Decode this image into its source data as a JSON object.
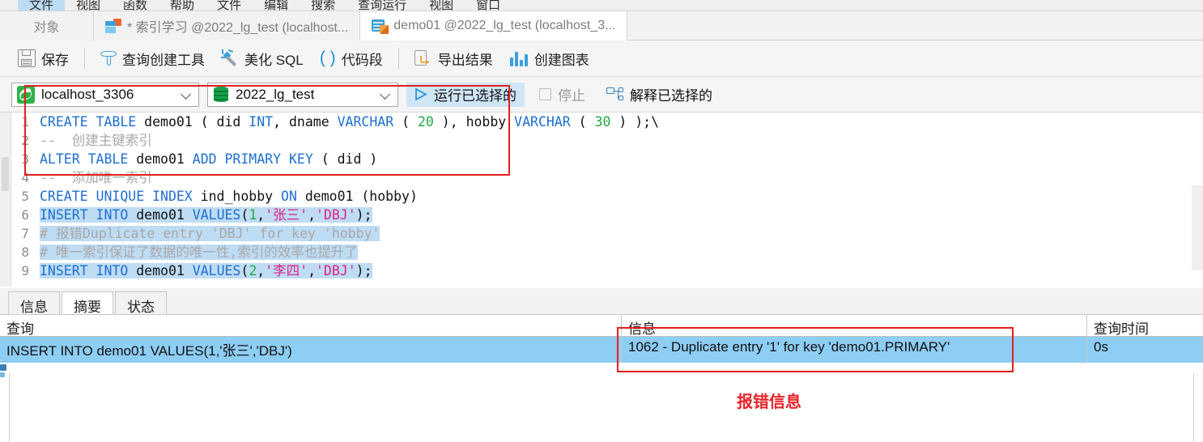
{
  "ribbon": {
    "tabs": [
      {
        "label": "文件",
        "active": true
      },
      {
        "label": "视图",
        "active": false
      },
      {
        "label": "函数",
        "active": false
      },
      {
        "label": "帮助",
        "active": false
      },
      {
        "label": "文件",
        "active": false
      },
      {
        "label": "编辑",
        "active": false
      },
      {
        "label": "搜索",
        "active": false
      },
      {
        "label": "查询运行",
        "active": false
      },
      {
        "label": "视图",
        "active": false
      },
      {
        "label": "窗口",
        "active": false
      }
    ]
  },
  "tabbar": {
    "objects_label": "对象",
    "tabs": [
      {
        "label": "* 索引学习 @2022_lg_test (localhost...",
        "icon": "query-icon",
        "active": false
      },
      {
        "label": "demo01 @2022_lg_test (localhost_3...",
        "icon": "table-editor-icon",
        "active": true
      }
    ]
  },
  "toolbar": {
    "save_label": "保存",
    "query_builder_label": "查询创建工具",
    "beautify_label": "美化 SQL",
    "snippet_label": "代码段",
    "export_label": "导出结果",
    "chart_label": "创建图表"
  },
  "runbar": {
    "connection": "localhost_3306",
    "database": "2022_lg_test",
    "run_selected_label": "运行已选择的",
    "stop_label": "停止",
    "explain_selected_label": "解释已选择的"
  },
  "editor": {
    "lines": [
      {
        "n": "1",
        "highlight": false,
        "tokens": [
          {
            "t": "CREATE TABLE ",
            "c": "kw"
          },
          {
            "t": "demo01",
            "c": "id"
          },
          {
            "t": " ( did ",
            "c": "pl"
          },
          {
            "t": "INT",
            "c": "kw"
          },
          {
            "t": ", dname ",
            "c": "pl"
          },
          {
            "t": "VARCHAR",
            "c": "kw"
          },
          {
            "t": " ( ",
            "c": "pl"
          },
          {
            "t": "20",
            "c": "num"
          },
          {
            "t": " ), hobby ",
            "c": "pl"
          },
          {
            "t": "VARCHAR",
            "c": "kw"
          },
          {
            "t": " ( ",
            "c": "pl"
          },
          {
            "t": "30",
            "c": "num"
          },
          {
            "t": " ) );\\",
            "c": "pl"
          }
        ]
      },
      {
        "n": "2",
        "highlight": false,
        "tokens": [
          {
            "t": "--  创建主键索引",
            "c": "cmt"
          }
        ]
      },
      {
        "n": "3",
        "highlight": false,
        "tokens": [
          {
            "t": "ALTER TABLE ",
            "c": "kw"
          },
          {
            "t": "demo01",
            "c": "id"
          },
          {
            "t": " ",
            "c": "pl"
          },
          {
            "t": "ADD PRIMARY KEY",
            "c": "kw"
          },
          {
            "t": " ( did )",
            "c": "pl"
          }
        ]
      },
      {
        "n": "4",
        "highlight": false,
        "tokens": [
          {
            "t": "--  添加唯一索引",
            "c": "cmt"
          }
        ]
      },
      {
        "n": "5",
        "highlight": false,
        "tokens": [
          {
            "t": "CREATE UNIQUE INDEX",
            "c": "kw"
          },
          {
            "t": " ind_hobby ",
            "c": "pl"
          },
          {
            "t": "ON",
            "c": "kw"
          },
          {
            "t": " demo01 (hobby)",
            "c": "pl"
          }
        ]
      },
      {
        "n": "6",
        "highlight": true,
        "tokens": [
          {
            "t": "INSERT INTO ",
            "c": "kw"
          },
          {
            "t": "demo01",
            "c": "id"
          },
          {
            "t": " ",
            "c": "pl"
          },
          {
            "t": "VALUES",
            "c": "kw"
          },
          {
            "t": "(",
            "c": "pl"
          },
          {
            "t": "1",
            "c": "num"
          },
          {
            "t": ",",
            "c": "pl"
          },
          {
            "t": "'张三'",
            "c": "str"
          },
          {
            "t": ",",
            "c": "pl"
          },
          {
            "t": "'DBJ'",
            "c": "str"
          },
          {
            "t": ");",
            "c": "pl"
          }
        ]
      },
      {
        "n": "7",
        "highlight": true,
        "tokens": [
          {
            "t": "# 报错Duplicate entry 'DBJ' for key 'hobby'",
            "c": "cmt"
          }
        ]
      },
      {
        "n": "8",
        "highlight": true,
        "tokens": [
          {
            "t": "# 唯一索引保证了数据的唯一性,索引的效率也提升了",
            "c": "cmt"
          }
        ]
      },
      {
        "n": "9",
        "highlight": true,
        "tokens": [
          {
            "t": "INSERT INTO ",
            "c": "kw"
          },
          {
            "t": "demo01",
            "c": "id"
          },
          {
            "t": " ",
            "c": "pl"
          },
          {
            "t": "VALUES",
            "c": "kw"
          },
          {
            "t": "(",
            "c": "pl"
          },
          {
            "t": "2",
            "c": "num"
          },
          {
            "t": ",",
            "c": "pl"
          },
          {
            "t": "'李四'",
            "c": "str"
          },
          {
            "t": ",",
            "c": "pl"
          },
          {
            "t": "'DBJ'",
            "c": "str"
          },
          {
            "t": ");",
            "c": "pl"
          }
        ]
      }
    ]
  },
  "result_tabs": [
    {
      "label": "信息",
      "active": false
    },
    {
      "label": "摘要",
      "active": true
    },
    {
      "label": "状态",
      "active": false
    }
  ],
  "result_grid": {
    "columns": [
      "查询",
      "信息",
      "查询时间"
    ],
    "rows": [
      [
        "INSERT INTO demo01 VALUES(1,'张三','DBJ')",
        "1062 - Duplicate entry '1' for key 'demo01.PRIMARY'",
        "0s"
      ]
    ]
  },
  "annotation": {
    "callout_label": "报错信息",
    "callout_color": "#e8232a",
    "highlight_box_color": "#e32020"
  }
}
